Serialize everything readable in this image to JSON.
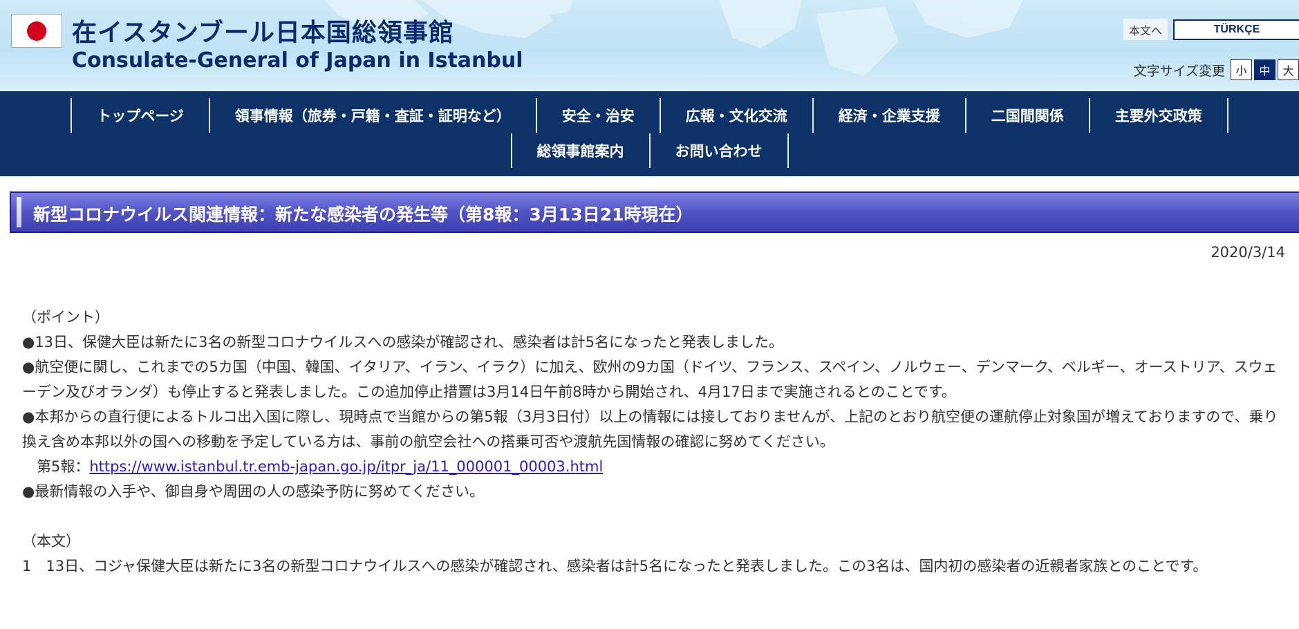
{
  "header": {
    "title_ja": "在イスタンブール日本国総領事館",
    "title_en": "Consulate-General of Japan in Istanbul",
    "honbun_link": "本文へ",
    "language_button": "TÜRKÇE",
    "font_size": {
      "label": "文字サイズ変更",
      "small": "小",
      "medium": "中",
      "large": "大",
      "selected": "中"
    }
  },
  "nav": {
    "row1": [
      "トップページ",
      "領事情報（旅券・戸籍・査証・証明など）",
      "安全・治安",
      "広報・文化交流",
      "経済・企業支援",
      "二国間関係",
      "主要外交政策"
    ],
    "row2": [
      "総領事館案内",
      "お問い合わせ"
    ]
  },
  "page": {
    "heading": "新型コロナウイルス関連情報：新たな感染者の発生等（第8報：3月13日21時現在）",
    "date": "2020/3/14"
  },
  "content": {
    "point_title": "（ポイント）",
    "bullet1": "●13日、保健大臣は新たに3名の新型コロナウイルスへの感染が確認され、感染者は計5名になったと発表しました。",
    "bullet2": "●航空便に関し、これまでの5カ国（中国、韓国、イタリア、イラン、イラク）に加え、欧州の9カ国（ドイツ、フランス、スペイン、ノルウェー、デンマーク、ベルギー、オーストリア、スウェーデン及びオランダ）も停止すると発表しました。この追加停止措置は3月14日午前8時から開始され、4月17日まで実施されるとのことです。",
    "bullet3": "●本邦からの直行便によるトルコ出入国に際し、現時点で当館からの第5報（3月3日付）以上の情報には接しておりませんが、上記のとおり航空便の運航停止対象国が増えておりますので、乗り換え含め本邦以外の国への移動を予定している方は、事前の航空会社への搭乗可否や渡航先国情報の確認に努めてください。",
    "ref_label": "　第5報：",
    "ref_url": "https://www.istanbul.tr.emb-japan.go.jp/itpr_ja/11_000001_00003.html",
    "bullet4": "●最新情報の入手や、御自身や周囲の人の感染予防に努めてください。",
    "main_title": "（本文）",
    "main_para1": "1　13日、コジャ保健大臣は新たに3名の新型コロナウイルスへの感染が確認され、感染者は計5名になったと発表しました。この3名は、国内初の感染者の近親者家族とのことです。"
  }
}
